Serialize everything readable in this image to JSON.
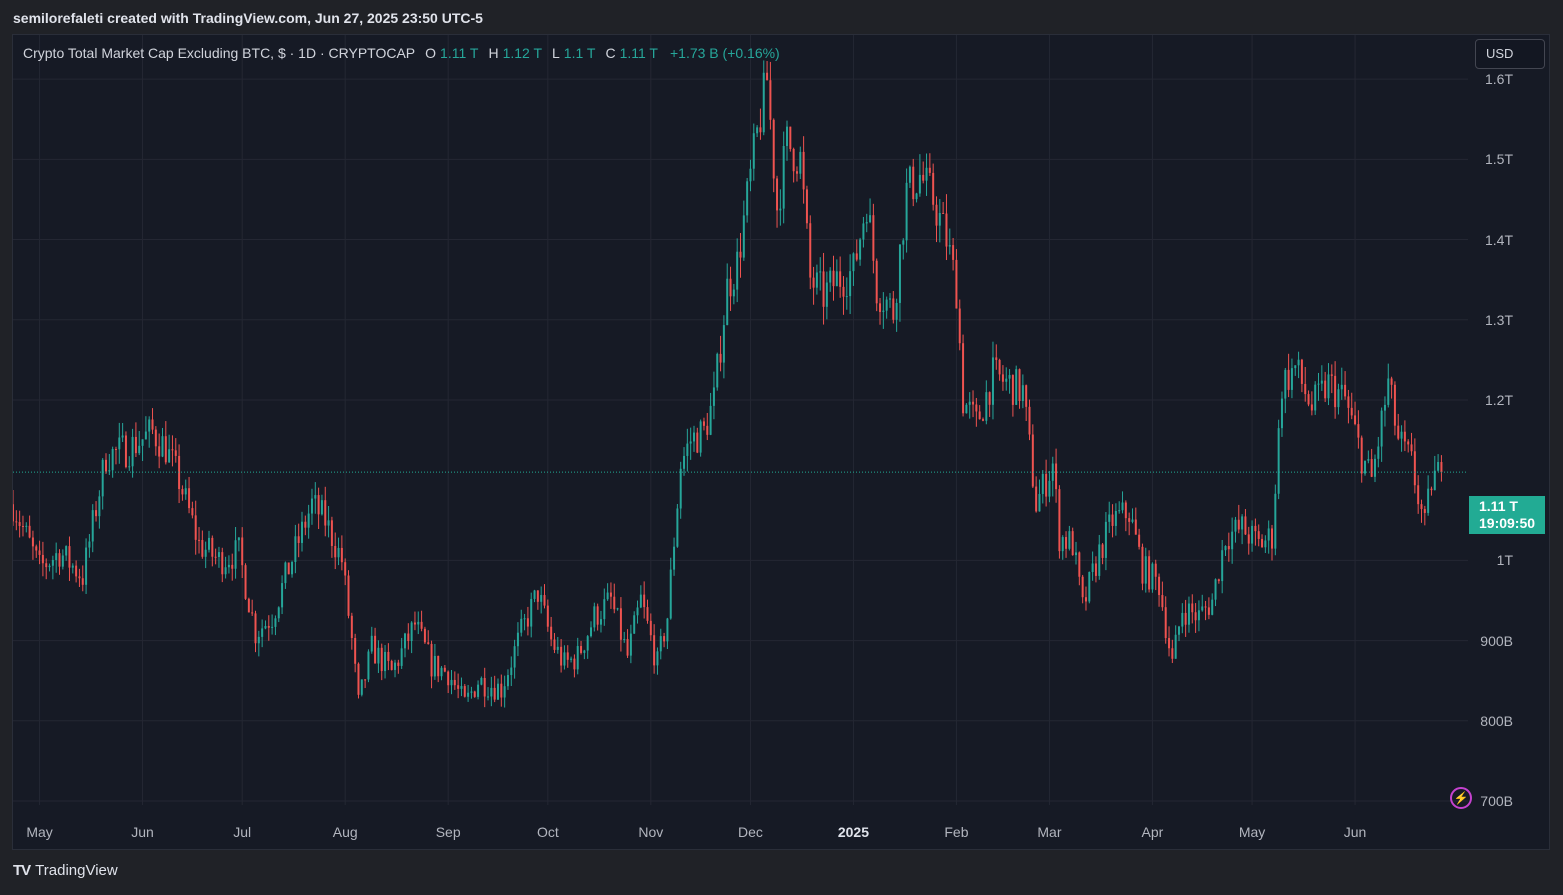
{
  "caption": "semilorefaleti created with TradingView.com, Jun 27, 2025 23:50 UTC-5",
  "legend": {
    "title": "Crypto Total Market Cap Excluding BTC, $ · 1D · CRYPTOCAP",
    "open_key": "O",
    "open": "1.11 T",
    "high_key": "H",
    "high": "1.12 T",
    "low_key": "L",
    "low": "1.1 T",
    "close_key": "C",
    "close": "1.11 T",
    "change": "+1.73 B (+0.16%)"
  },
  "currency_button": "USD",
  "last_price": {
    "value": "1.11 T",
    "countdown": "19:09:50"
  },
  "brand": {
    "logo": "TV",
    "name": "TradingView"
  },
  "colors": {
    "up": "#26a69a",
    "down": "#ef5350",
    "accent": "#22ab94",
    "background": "#161a25"
  },
  "chart_data": {
    "type": "candlestick",
    "interval": "1D",
    "currency": "USD",
    "y_axis": {
      "unit": "USD",
      "ticks": [
        {
          "value": 1600000000000,
          "label": "1.6T"
        },
        {
          "value": 1500000000000,
          "label": "1.5T"
        },
        {
          "value": 1400000000000,
          "label": "1.4T"
        },
        {
          "value": 1300000000000,
          "label": "1.3T"
        },
        {
          "value": 1200000000000,
          "label": "1.2T"
        },
        {
          "value": 1000000000000,
          "label": "1T"
        },
        {
          "value": 900000000000,
          "label": "900B"
        },
        {
          "value": 800000000000,
          "label": "800B"
        },
        {
          "value": 700000000000,
          "label": "700B"
        }
      ],
      "range": [
        695000000000,
        1655000000000
      ]
    },
    "x_axis": {
      "ticks": [
        {
          "date": "2024-05-01",
          "label": "May",
          "bold": false
        },
        {
          "date": "2024-06-01",
          "label": "Jun",
          "bold": false
        },
        {
          "date": "2024-07-01",
          "label": "Jul",
          "bold": false
        },
        {
          "date": "2024-08-01",
          "label": "Aug",
          "bold": false
        },
        {
          "date": "2024-09-01",
          "label": "Sep",
          "bold": false
        },
        {
          "date": "2024-10-01",
          "label": "Oct",
          "bold": false
        },
        {
          "date": "2024-11-01",
          "label": "Nov",
          "bold": false
        },
        {
          "date": "2024-12-01",
          "label": "Dec",
          "bold": false
        },
        {
          "date": "2025-01-01",
          "label": "2025",
          "bold": true
        },
        {
          "date": "2025-02-01",
          "label": "Feb",
          "bold": false
        },
        {
          "date": "2025-03-01",
          "label": "Mar",
          "bold": false
        },
        {
          "date": "2025-04-01",
          "label": "Apr",
          "bold": false
        },
        {
          "date": "2025-05-01",
          "label": "May",
          "bold": false
        },
        {
          "date": "2025-06-01",
          "label": "Jun",
          "bold": false
        }
      ],
      "range": [
        "2024-04-23",
        "2025-07-05"
      ]
    },
    "grid": true,
    "last_close": 1110000000000,
    "close_path": [
      [
        "2024-04-23",
        1.07
      ],
      [
        "2024-05-01",
        0.99
      ],
      [
        "2024-05-07",
        1.01
      ],
      [
        "2024-05-14",
        0.98
      ],
      [
        "2024-05-21",
        1.13
      ],
      [
        "2024-05-28",
        1.14
      ],
      [
        "2024-06-04",
        1.16
      ],
      [
        "2024-06-08",
        1.14
      ],
      [
        "2024-06-12",
        1.1
      ],
      [
        "2024-06-18",
        1.02
      ],
      [
        "2024-06-24",
        1.0
      ],
      [
        "2024-06-30",
        1.01
      ],
      [
        "2024-07-05",
        0.91
      ],
      [
        "2024-07-10",
        0.93
      ],
      [
        "2024-07-15",
        0.99
      ],
      [
        "2024-07-22",
        1.07
      ],
      [
        "2024-07-26",
        1.05
      ],
      [
        "2024-07-31",
        1.0
      ],
      [
        "2024-08-03",
        0.9
      ],
      [
        "2024-08-05",
        0.82
      ],
      [
        "2024-08-09",
        0.89
      ],
      [
        "2024-08-15",
        0.86
      ],
      [
        "2024-08-22",
        0.92
      ],
      [
        "2024-08-27",
        0.87
      ],
      [
        "2024-09-01",
        0.86
      ],
      [
        "2024-09-06",
        0.82
      ],
      [
        "2024-09-10",
        0.85
      ],
      [
        "2024-09-17",
        0.84
      ],
      [
        "2024-09-23",
        0.91
      ],
      [
        "2024-09-28",
        0.96
      ],
      [
        "2024-10-02",
        0.9
      ],
      [
        "2024-10-06",
        0.87
      ],
      [
        "2024-10-10",
        0.88
      ],
      [
        "2024-10-15",
        0.93
      ],
      [
        "2024-10-20",
        0.95
      ],
      [
        "2024-10-25",
        0.88
      ],
      [
        "2024-10-29",
        0.95
      ],
      [
        "2024-11-03",
        0.87
      ],
      [
        "2024-11-06",
        0.93
      ],
      [
        "2024-11-10",
        1.12
      ],
      [
        "2024-11-13",
        1.15
      ],
      [
        "2024-11-17",
        1.16
      ],
      [
        "2024-11-20",
        1.2
      ],
      [
        "2024-11-24",
        1.34
      ],
      [
        "2024-11-27",
        1.37
      ],
      [
        "2024-12-03",
        1.53
      ],
      [
        "2024-12-06",
        1.6
      ],
      [
        "2024-12-09",
        1.44
      ],
      [
        "2024-12-12",
        1.52
      ],
      [
        "2024-12-16",
        1.5
      ],
      [
        "2024-12-19",
        1.35
      ],
      [
        "2024-12-23",
        1.33
      ],
      [
        "2024-12-27",
        1.35
      ],
      [
        "2025-01-01",
        1.36
      ],
      [
        "2025-01-05",
        1.45
      ],
      [
        "2025-01-08",
        1.34
      ],
      [
        "2025-01-13",
        1.31
      ],
      [
        "2025-01-17",
        1.46
      ],
      [
        "2025-01-21",
        1.48
      ],
      [
        "2025-01-25",
        1.45
      ],
      [
        "2025-01-29",
        1.4
      ],
      [
        "2025-02-01",
        1.34
      ],
      [
        "2025-02-03",
        1.2
      ],
      [
        "2025-02-07",
        1.17
      ],
      [
        "2025-02-12",
        1.23
      ],
      [
        "2025-02-17",
        1.22
      ],
      [
        "2025-02-21",
        1.21
      ],
      [
        "2025-02-25",
        1.07
      ],
      [
        "2025-03-02",
        1.12
      ],
      [
        "2025-03-04",
        1.03
      ],
      [
        "2025-03-08",
        1.02
      ],
      [
        "2025-03-11",
        0.94
      ],
      [
        "2025-03-16",
        1.01
      ],
      [
        "2025-03-20",
        1.05
      ],
      [
        "2025-03-25",
        1.06
      ],
      [
        "2025-03-29",
        0.99
      ],
      [
        "2025-04-03",
        0.97
      ],
      [
        "2025-04-07",
        0.87
      ],
      [
        "2025-04-10",
        0.94
      ],
      [
        "2025-04-15",
        0.93
      ],
      [
        "2025-04-19",
        0.95
      ],
      [
        "2025-04-23",
        1.03
      ],
      [
        "2025-04-28",
        1.04
      ],
      [
        "2025-05-03",
        1.02
      ],
      [
        "2025-05-07",
        1.03
      ],
      [
        "2025-05-10",
        1.22
      ],
      [
        "2025-05-14",
        1.24
      ],
      [
        "2025-05-19",
        1.19
      ],
      [
        "2025-05-24",
        1.22
      ],
      [
        "2025-05-29",
        1.2
      ],
      [
        "2025-06-03",
        1.13
      ],
      [
        "2025-06-06",
        1.1
      ],
      [
        "2025-06-11",
        1.22
      ],
      [
        "2025-06-14",
        1.15
      ],
      [
        "2025-06-18",
        1.12
      ],
      [
        "2025-06-22",
        1.04
      ],
      [
        "2025-06-24",
        1.1
      ],
      [
        "2025-06-27",
        1.11
      ]
    ]
  }
}
